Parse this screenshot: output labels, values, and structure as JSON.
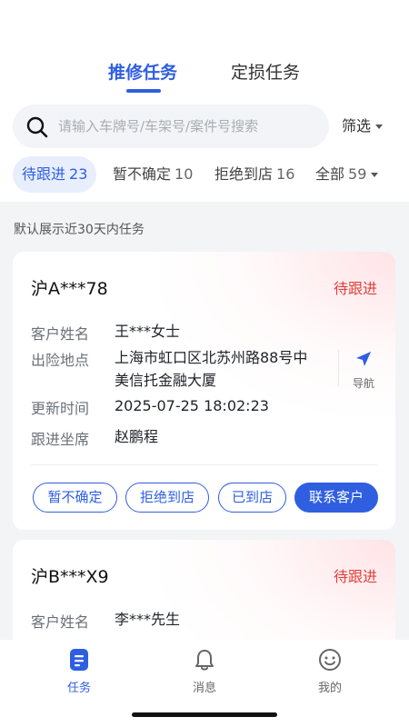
{
  "tabs": {
    "repair": "推修任务",
    "loss": "定损任务"
  },
  "search": {
    "placeholder": "请输入车牌号/车架号/案件号搜索"
  },
  "filter_label": "筛选",
  "status_filters": [
    {
      "label": "待跟进",
      "count": "23"
    },
    {
      "label": "暂不确定",
      "count": "10"
    },
    {
      "label": "拒绝到店",
      "count": "16"
    },
    {
      "label": "全部",
      "count": "59"
    }
  ],
  "note": "默认展示近30天内任务",
  "labels": {
    "customer_name": "客户姓名",
    "location": "出险地点",
    "updated": "更新时间",
    "agent": "跟进坐席",
    "navigate": "导航"
  },
  "cards": [
    {
      "plate": "沪A***78",
      "status": "待跟进",
      "customer_name": "王***女士",
      "location_line1": "上海市虹口区北苏州路88号中",
      "location_line2": "美信托金融大厦",
      "updated": "2025-07-25 18:02:23",
      "agent": "赵鹏程",
      "actions": [
        "暂不确定",
        "拒绝到店",
        "已到店",
        "联系客户"
      ]
    },
    {
      "plate": "沪B***X9",
      "status": "待跟进",
      "customer_name": "李***先生"
    }
  ],
  "bottom_tabs": [
    {
      "label": "任务",
      "icon": "task-icon",
      "active": true
    },
    {
      "label": "消息",
      "icon": "bell-icon",
      "active": false
    },
    {
      "label": "我的",
      "icon": "smiley-icon",
      "active": false
    }
  ],
  "colors": {
    "accent": "#2f5fe0",
    "status_red": "#e0403a"
  }
}
